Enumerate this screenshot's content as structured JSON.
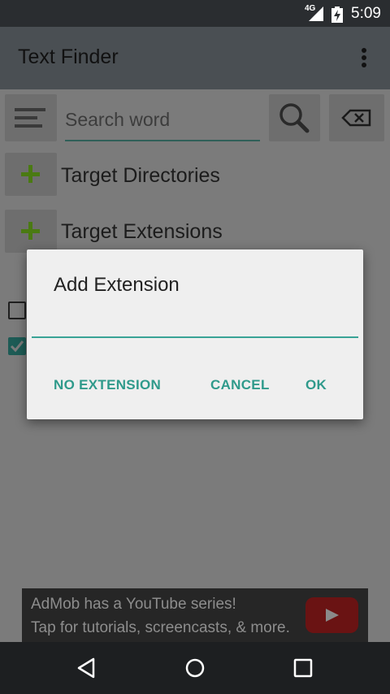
{
  "status_bar": {
    "network": "4G",
    "time": "5:09"
  },
  "app_bar": {
    "title": "Text Finder",
    "overflow_icon": "more-vert-icon"
  },
  "search": {
    "menu_icon": "hamburger-icon",
    "placeholder": "Search word",
    "value": "",
    "search_icon": "magnifier-icon",
    "clear_icon": "backspace-icon"
  },
  "sections": [
    {
      "icon": "plus-icon",
      "label": "Target Directories"
    },
    {
      "icon": "plus-icon",
      "label": "Target Extensions"
    }
  ],
  "checkboxes": [
    {
      "checked": false
    },
    {
      "checked": true
    }
  ],
  "dialog": {
    "title": "Add Extension",
    "input_value": "",
    "buttons": {
      "no_extension": "NO EXTENSION",
      "cancel": "CANCEL",
      "ok": "OK"
    },
    "accent_color": "#2f9a8b"
  },
  "ad": {
    "line1": "AdMob has a YouTube series!",
    "line2": "Tap for tutorials, screencasts, & more."
  },
  "nav_bar": {
    "back_icon": "back-triangle-icon",
    "home_icon": "home-circle-icon",
    "recents_icon": "recents-square-icon"
  }
}
